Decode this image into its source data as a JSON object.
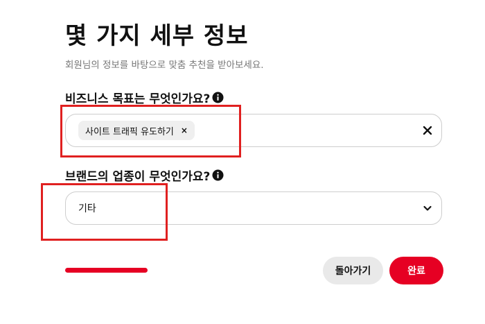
{
  "header": {
    "title": "몇 가지 세부 정보",
    "subtitle": "회원님의 정보를 바탕으로 맞춤 추천을 받아보세요."
  },
  "question1": {
    "label": "비즈니스 목표는 무엇인가요?",
    "selected_chip": "사이트 트래픽 유도하기",
    "chip_remove_glyph": "×",
    "icon": "info-icon"
  },
  "question2": {
    "label": "브랜드의 업종이 무엇인가요?",
    "selected_value": "기타",
    "icon": "info-icon"
  },
  "footer": {
    "back_label": "돌아가기",
    "done_label": "완료"
  },
  "colors": {
    "accent": "#e60023",
    "highlight": "#e02020",
    "chip_bg": "#efefef",
    "back_bg": "#e9e9e9"
  }
}
